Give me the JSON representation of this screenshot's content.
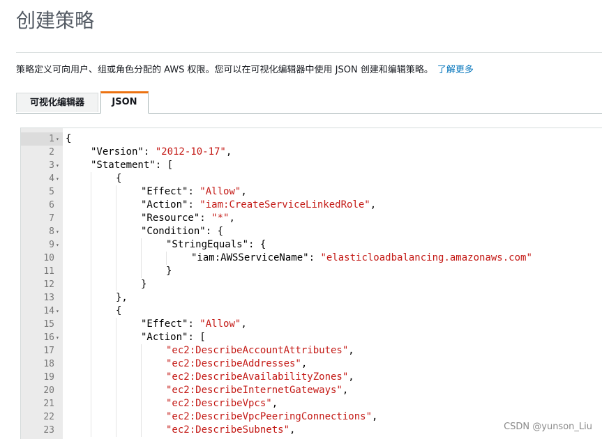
{
  "page": {
    "title": "创建策略",
    "description": "策略定义可向用户、组或角色分配的 AWS 权限。您可以在可视化编辑器中使用 JSON 创建和编辑策略。",
    "learn_more": "了解更多"
  },
  "tabs": [
    {
      "label": "可视化编辑器",
      "active": false
    },
    {
      "label": "JSON",
      "active": true
    }
  ],
  "editor": {
    "lines": [
      {
        "n": "1",
        "fold": true,
        "indent": 0,
        "parts": [
          {
            "t": "p",
            "v": "{"
          }
        ]
      },
      {
        "n": "2",
        "fold": false,
        "indent": 1,
        "parts": [
          {
            "t": "k",
            "v": "\"Version\""
          },
          {
            "t": "p",
            "v": ": "
          },
          {
            "t": "s",
            "v": "\"2012-10-17\""
          },
          {
            "t": "p",
            "v": ","
          }
        ]
      },
      {
        "n": "3",
        "fold": true,
        "indent": 1,
        "parts": [
          {
            "t": "k",
            "v": "\"Statement\""
          },
          {
            "t": "p",
            "v": ": ["
          }
        ]
      },
      {
        "n": "4",
        "fold": true,
        "indent": 2,
        "parts": [
          {
            "t": "p",
            "v": "{"
          }
        ]
      },
      {
        "n": "5",
        "fold": false,
        "indent": 3,
        "parts": [
          {
            "t": "k",
            "v": "\"Effect\""
          },
          {
            "t": "p",
            "v": ": "
          },
          {
            "t": "s",
            "v": "\"Allow\""
          },
          {
            "t": "p",
            "v": ","
          }
        ]
      },
      {
        "n": "6",
        "fold": false,
        "indent": 3,
        "parts": [
          {
            "t": "k",
            "v": "\"Action\""
          },
          {
            "t": "p",
            "v": ": "
          },
          {
            "t": "s",
            "v": "\"iam:CreateServiceLinkedRole\""
          },
          {
            "t": "p",
            "v": ","
          }
        ]
      },
      {
        "n": "7",
        "fold": false,
        "indent": 3,
        "parts": [
          {
            "t": "k",
            "v": "\"Resource\""
          },
          {
            "t": "p",
            "v": ": "
          },
          {
            "t": "s",
            "v": "\"*\""
          },
          {
            "t": "p",
            "v": ","
          }
        ]
      },
      {
        "n": "8",
        "fold": true,
        "indent": 3,
        "parts": [
          {
            "t": "k",
            "v": "\"Condition\""
          },
          {
            "t": "p",
            "v": ": {"
          }
        ]
      },
      {
        "n": "9",
        "fold": true,
        "indent": 4,
        "parts": [
          {
            "t": "k",
            "v": "\"StringEquals\""
          },
          {
            "t": "p",
            "v": ": {"
          }
        ]
      },
      {
        "n": "10",
        "fold": false,
        "indent": 5,
        "parts": [
          {
            "t": "k",
            "v": "\"iam:AWSServiceName\""
          },
          {
            "t": "p",
            "v": ": "
          },
          {
            "t": "s",
            "v": "\"elasticloadbalancing.amazonaws.com\""
          }
        ]
      },
      {
        "n": "11",
        "fold": false,
        "indent": 4,
        "parts": [
          {
            "t": "p",
            "v": "}"
          }
        ]
      },
      {
        "n": "12",
        "fold": false,
        "indent": 3,
        "parts": [
          {
            "t": "p",
            "v": "}"
          }
        ]
      },
      {
        "n": "13",
        "fold": false,
        "indent": 2,
        "parts": [
          {
            "t": "p",
            "v": "},"
          }
        ]
      },
      {
        "n": "14",
        "fold": true,
        "indent": 2,
        "parts": [
          {
            "t": "p",
            "v": "{"
          }
        ]
      },
      {
        "n": "15",
        "fold": false,
        "indent": 3,
        "parts": [
          {
            "t": "k",
            "v": "\"Effect\""
          },
          {
            "t": "p",
            "v": ": "
          },
          {
            "t": "s",
            "v": "\"Allow\""
          },
          {
            "t": "p",
            "v": ","
          }
        ]
      },
      {
        "n": "16",
        "fold": true,
        "indent": 3,
        "parts": [
          {
            "t": "k",
            "v": "\"Action\""
          },
          {
            "t": "p",
            "v": ": ["
          }
        ]
      },
      {
        "n": "17",
        "fold": false,
        "indent": 4,
        "parts": [
          {
            "t": "s",
            "v": "\"ec2:DescribeAccountAttributes\""
          },
          {
            "t": "p",
            "v": ","
          }
        ]
      },
      {
        "n": "18",
        "fold": false,
        "indent": 4,
        "parts": [
          {
            "t": "s",
            "v": "\"ec2:DescribeAddresses\""
          },
          {
            "t": "p",
            "v": ","
          }
        ]
      },
      {
        "n": "19",
        "fold": false,
        "indent": 4,
        "parts": [
          {
            "t": "s",
            "v": "\"ec2:DescribeAvailabilityZones\""
          },
          {
            "t": "p",
            "v": ","
          }
        ]
      },
      {
        "n": "20",
        "fold": false,
        "indent": 4,
        "parts": [
          {
            "t": "s",
            "v": "\"ec2:DescribeInternetGateways\""
          },
          {
            "t": "p",
            "v": ","
          }
        ]
      },
      {
        "n": "21",
        "fold": false,
        "indent": 4,
        "parts": [
          {
            "t": "s",
            "v": "\"ec2:DescribeVpcs\""
          },
          {
            "t": "p",
            "v": ","
          }
        ]
      },
      {
        "n": "22",
        "fold": false,
        "indent": 4,
        "parts": [
          {
            "t": "s",
            "v": "\"ec2:DescribeVpcPeeringConnections\""
          },
          {
            "t": "p",
            "v": ","
          }
        ]
      },
      {
        "n": "23",
        "fold": false,
        "indent": 4,
        "parts": [
          {
            "t": "s",
            "v": "\"ec2:DescribeSubnets\""
          },
          {
            "t": "p",
            "v": ","
          }
        ]
      }
    ]
  },
  "watermark": "CSDN @yunson_Liu"
}
